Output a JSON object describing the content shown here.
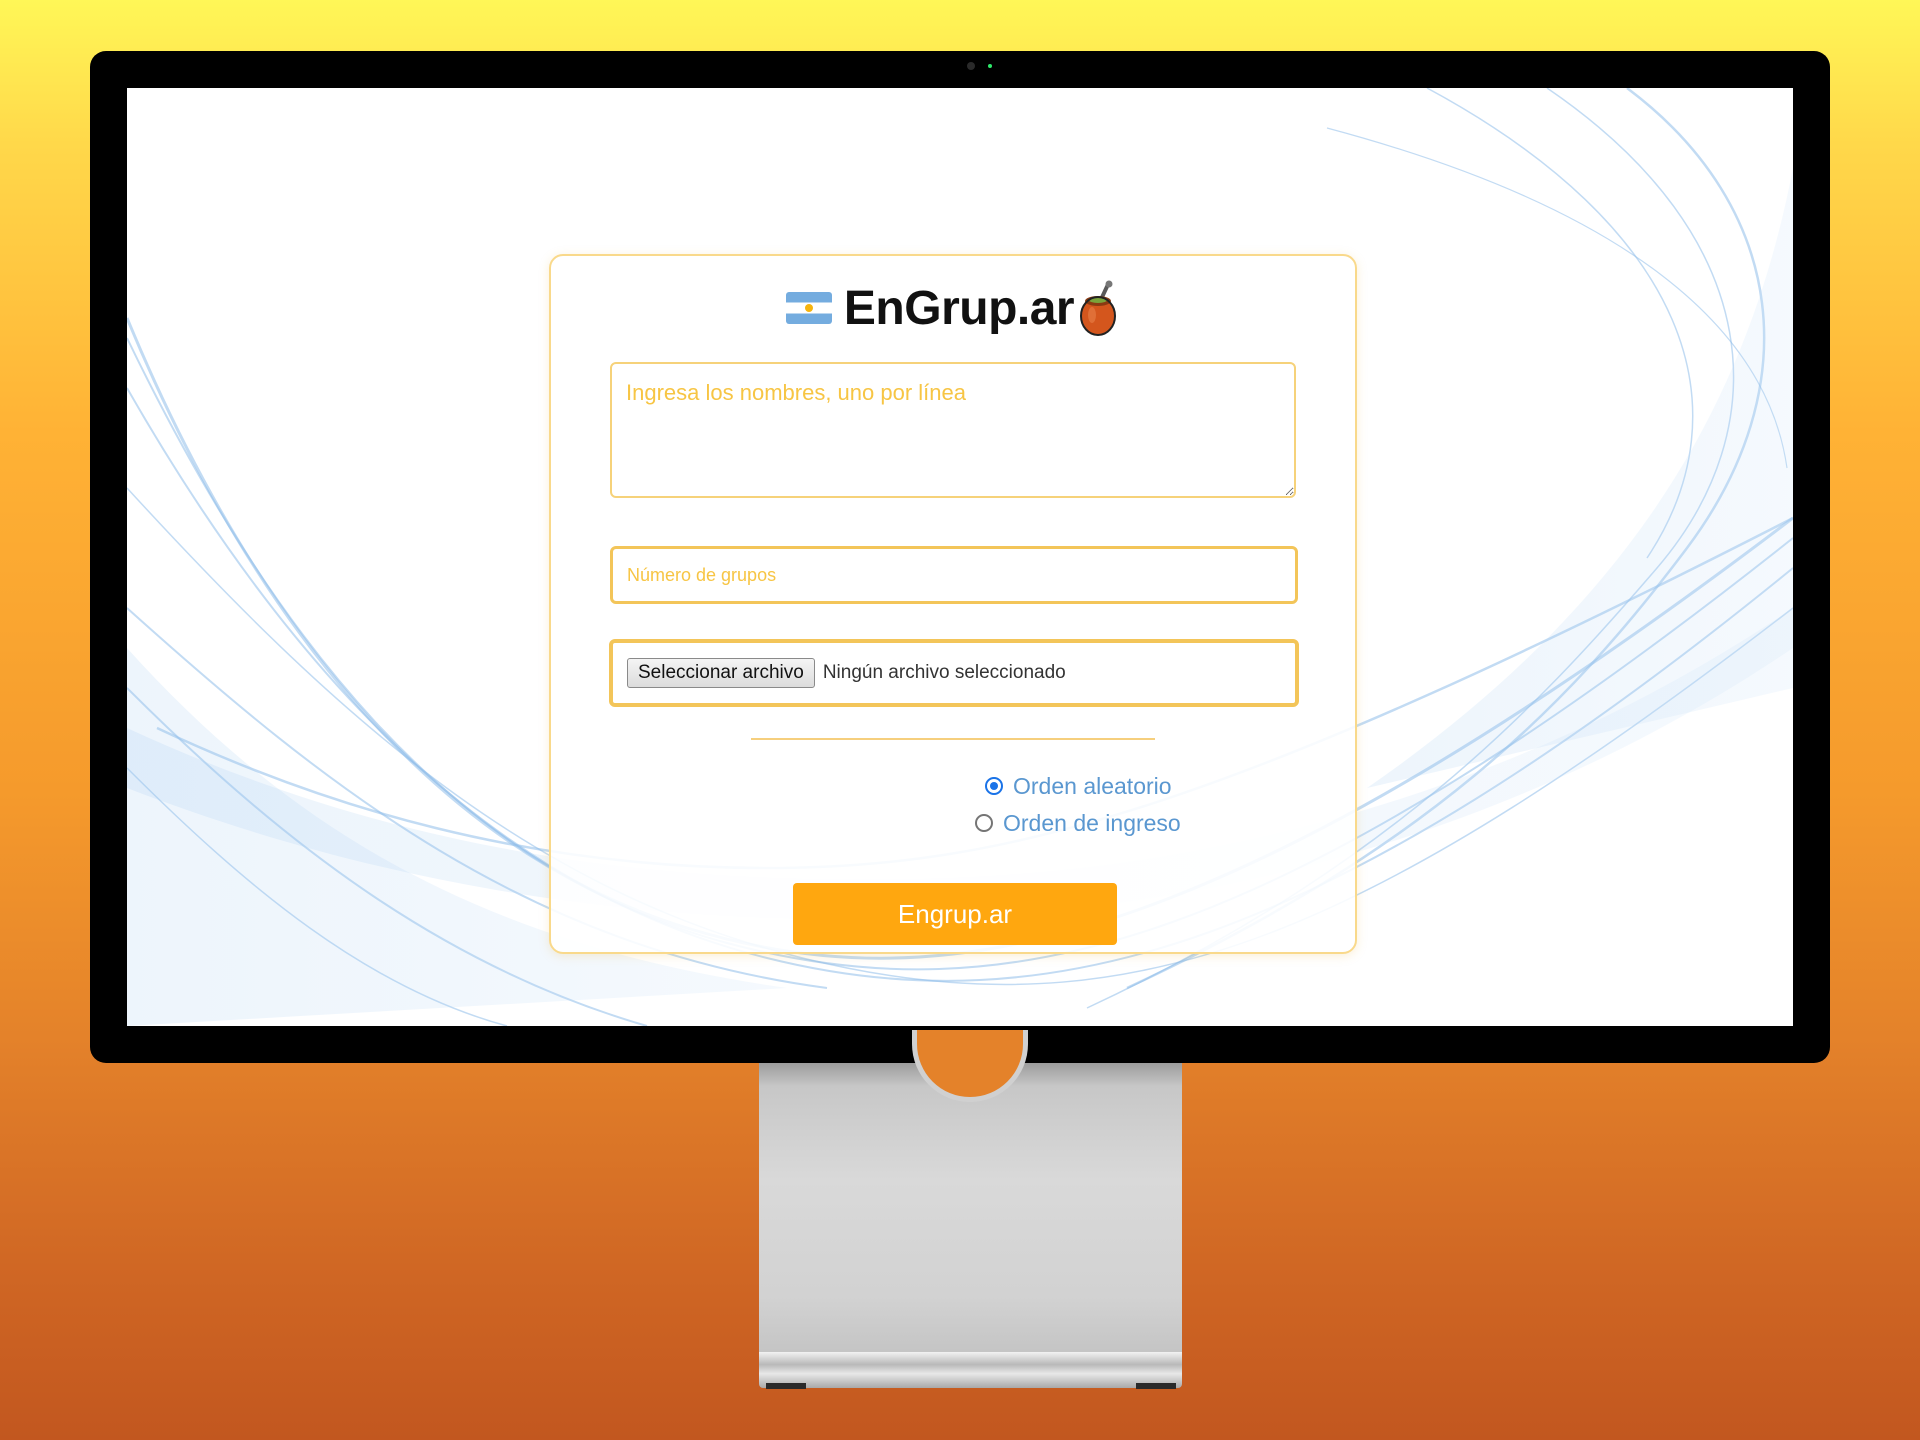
{
  "app": {
    "title": "EnGrup.ar",
    "flag_icon": "argentina-flag-icon",
    "mate_icon": "mate-gourd-icon"
  },
  "form": {
    "names_placeholder": "Ingresa los nombres, uno por línea",
    "names_value": "",
    "groups_placeholder": "Número de grupos",
    "groups_value": "",
    "file_button_label": "Seleccionar archivo",
    "file_status": "Ningún archivo seleccionado",
    "order_options": [
      {
        "label": "Orden aleatorio",
        "selected": true
      },
      {
        "label": "Orden de ingreso",
        "selected": false
      }
    ],
    "submit_label": "Engrup.ar"
  },
  "colors": {
    "accent": "#ffa70f",
    "field_border": "#f3c559",
    "placeholder": "#f7c544",
    "radio_label": "#5a97d0",
    "radio_selected": "#1a73e8"
  }
}
